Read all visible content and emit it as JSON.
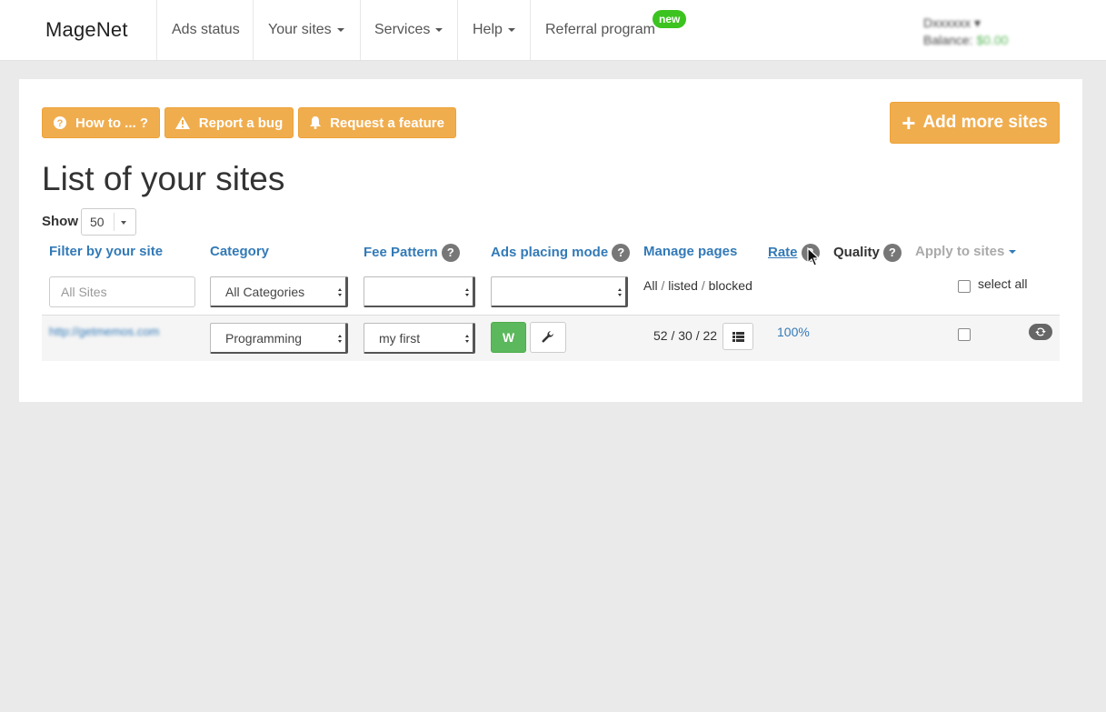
{
  "navbar": {
    "brand": "MageNet",
    "items": [
      {
        "label": "Ads status",
        "dropdown": false
      },
      {
        "label": "Your sites",
        "dropdown": true
      },
      {
        "label": "Services",
        "dropdown": true
      },
      {
        "label": "Help",
        "dropdown": true
      },
      {
        "label": "Referral program",
        "dropdown": false
      }
    ],
    "new_badge": "new",
    "user": {
      "name": "Dxxxxxx",
      "balance_label": "Balance:",
      "balance_value": "$0.00"
    }
  },
  "toolbar": {
    "how_to": "How to ... ?",
    "report_bug": "Report a bug",
    "request_feature": "Request a feature",
    "add_sites": "Add more sites"
  },
  "page": {
    "title": "List of your sites",
    "show_label": "Show",
    "show_value": "50"
  },
  "table": {
    "headers": {
      "filter_site": "Filter by your site",
      "category": "Category",
      "fee_pattern": "Fee Pattern",
      "ads_mode": "Ads placing mode",
      "manage_pages": "Manage pages",
      "rate": "Rate",
      "quality": "Quality",
      "apply": "Apply to sites"
    },
    "help_glyph": "?",
    "filters": {
      "site_placeholder": "All Sites",
      "category_value": "All Categories",
      "fee_value": "",
      "ads_value": "",
      "pages_all": "All",
      "pages_listed": "listed",
      "pages_blocked": "blocked",
      "slash": "/",
      "select_all": "select all"
    },
    "rows": [
      {
        "url": "http://getmemos.com",
        "category": "Programming",
        "fee_pattern": "my first",
        "ads_mode": "W",
        "pages_all": "52",
        "pages_listed": "30",
        "pages_blocked": "22",
        "rate": "100%"
      }
    ]
  },
  "colors": {
    "accent": "#337ab7",
    "warning": "#f0ad4e",
    "success": "#5cb85c",
    "badge_new": "#3cc31f"
  },
  "icons": [
    "question-circle-icon",
    "warning-triangle-icon",
    "bell-icon",
    "plus-icon",
    "wrench-icon",
    "list-icon",
    "refresh-icon",
    "mouse-pointer-icon"
  ]
}
